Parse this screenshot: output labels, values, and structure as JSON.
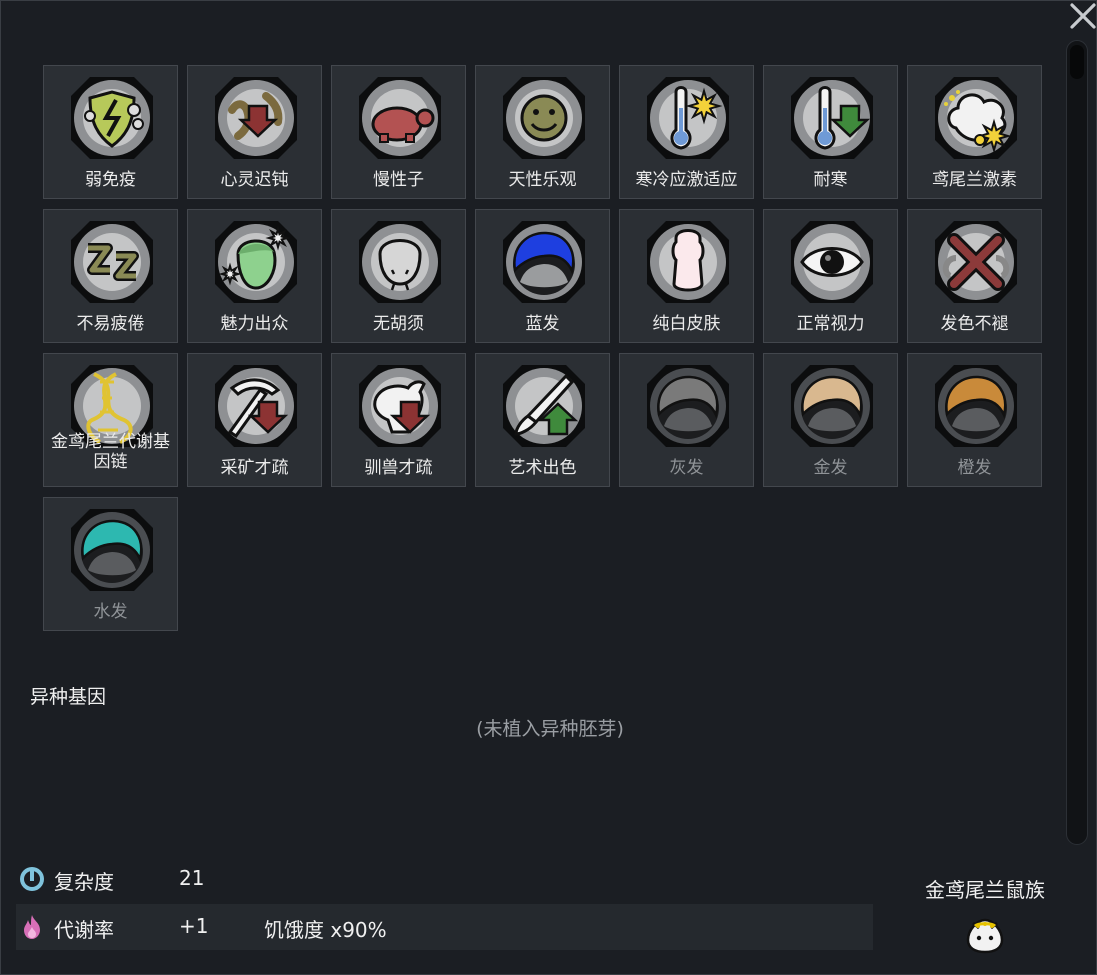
{
  "genes": [
    {
      "label": "弱免疫",
      "icon": "weak-immunity-icon",
      "dim": false
    },
    {
      "label": "心灵迟钝",
      "icon": "psychic-dull-icon",
      "dim": false
    },
    {
      "label": "慢性子",
      "icon": "turtle-icon",
      "dim": false
    },
    {
      "label": "天性乐观",
      "icon": "smiley-icon",
      "dim": false
    },
    {
      "label": "寒冷应激适应",
      "icon": "cold-stress-icon",
      "dim": false
    },
    {
      "label": "耐寒",
      "icon": "cold-resist-icon",
      "dim": false
    },
    {
      "label": "鸢尾兰激素",
      "icon": "hormone-cloud-icon",
      "dim": false
    },
    {
      "label": "不易疲倦",
      "icon": "sleep-zz-icon",
      "dim": false
    },
    {
      "label": "魅力出众",
      "icon": "beautiful-face-icon",
      "dim": false
    },
    {
      "label": "无胡须",
      "icon": "no-beard-icon",
      "dim": false
    },
    {
      "label": "蓝发",
      "icon": "blue-hair-icon",
      "dim": false
    },
    {
      "label": "纯白皮肤",
      "icon": "white-skin-icon",
      "dim": false
    },
    {
      "label": "正常视力",
      "icon": "eye-icon",
      "dim": false
    },
    {
      "label": "发色不褪",
      "icon": "no-hair-fade-icon",
      "dim": false
    },
    {
      "label": "金鸢尾兰代谢基因链",
      "icon": "dna-strand-icon",
      "dim": false
    },
    {
      "label": "采矿才疏",
      "icon": "mining-pick-icon",
      "dim": false
    },
    {
      "label": "驯兽才疏",
      "icon": "animal-tame-icon",
      "dim": false
    },
    {
      "label": "艺术出色",
      "icon": "art-brush-icon",
      "dim": false
    },
    {
      "label": "灰发",
      "icon": "gray-hair-icon",
      "dim": true
    },
    {
      "label": "金发",
      "icon": "blond-hair-icon",
      "dim": true
    },
    {
      "label": "橙发",
      "icon": "orange-hair-icon",
      "dim": true
    },
    {
      "label": "水发",
      "icon": "aqua-hair-icon",
      "dim": true
    }
  ],
  "xenogenes": {
    "title": "异种基因",
    "empty_note": "(未植入异种胚芽)"
  },
  "stats": {
    "complexity": {
      "label": "复杂度",
      "value": "21",
      "icon": "complexity-icon"
    },
    "metabolism": {
      "label": "代谢率",
      "value": "+1",
      "extra": "饥饿度 x90%",
      "icon": "metabolism-flame-icon"
    }
  },
  "xenotype": {
    "name": "金鸢尾兰鼠族",
    "icon": "xenotype-icon"
  },
  "colors": {
    "background": "#1b1e23",
    "tile": "#2b2f34",
    "hair_blue": "#1e3fe0",
    "hair_gray": "#7a7a7a",
    "hair_blond": "#d9b88f",
    "hair_orange": "#c98a3a",
    "hair_aqua": "#2db8b0",
    "arrow_red": "#8c3333",
    "arrow_green": "#3f8a3c"
  }
}
